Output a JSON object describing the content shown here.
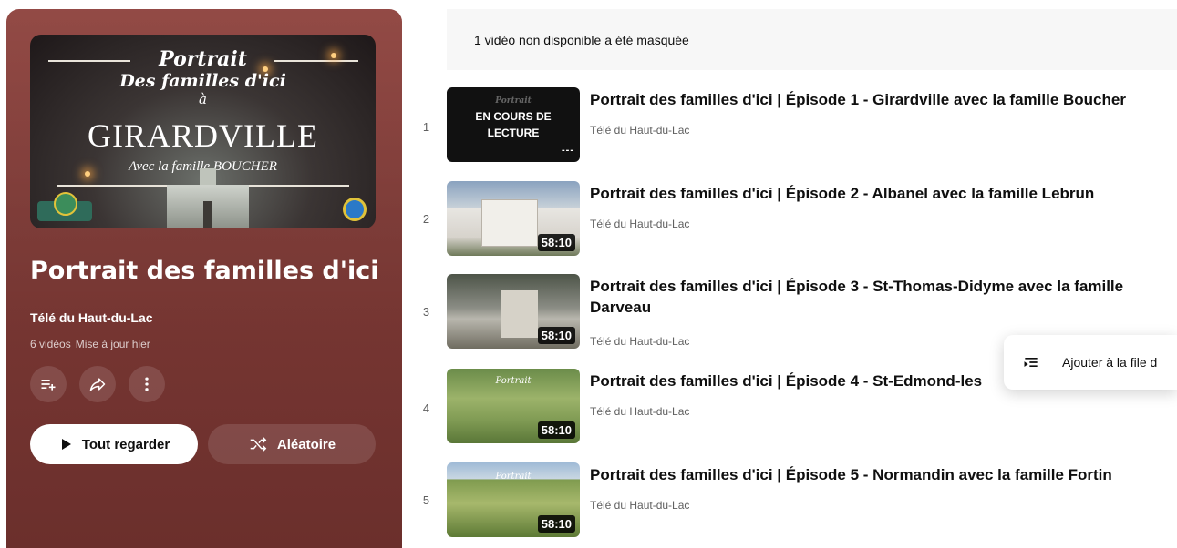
{
  "hero": {
    "line1": "Portrait",
    "line2": "Des familles d'ici",
    "line3": "à",
    "line4": "GIRARDVILLE",
    "line5": "Avec la famille BOUCHER",
    "logo_text": "GIRARDVILLE"
  },
  "playlist": {
    "title": "Portrait des familles d'ici",
    "channel": "Télé du Haut-du-Lac",
    "video_count": "6 vidéos",
    "updated": "Mise à jour hier"
  },
  "actions": {
    "save_icon": "playlist-add-icon",
    "share_icon": "share-icon",
    "more_icon": "more-vert-icon",
    "play_all": "Tout regarder",
    "shuffle": "Aléatoire"
  },
  "notice": "1 vidéo non disponible a été masquée",
  "videos": [
    {
      "index": "1",
      "title": "Portrait des familles d'ici | Épisode 1 - Girardville avec la famille Boucher",
      "channel": "Télé du Haut-du-Lac",
      "now_playing": "EN COURS DE LECTURE",
      "bars": "---"
    },
    {
      "index": "2",
      "title": "Portrait des familles d'ici | Épisode 2 - Albanel avec la famille Lebrun",
      "channel": "Télé du Haut-du-Lac",
      "duration": "58:10"
    },
    {
      "index": "3",
      "title": "Portrait des familles d'ici | Épisode 3 - St-Thomas-Didyme avec la famille Darveau",
      "channel": "Télé du Haut-du-Lac",
      "duration": "58:10"
    },
    {
      "index": "4",
      "title": "Portrait des familles d'ici | Épisode 4 - St-Edmond-les",
      "channel": "Télé du Haut-du-Lac",
      "duration": "58:10"
    },
    {
      "index": "5",
      "title": "Portrait des familles d'ici | Épisode 5 - Normandin avec la famille Fortin",
      "channel": "Télé du Haut-du-Lac",
      "duration": "58:10"
    }
  ],
  "context_menu": {
    "icon": "add-to-queue-icon",
    "label": "Ajouter à la file d"
  }
}
